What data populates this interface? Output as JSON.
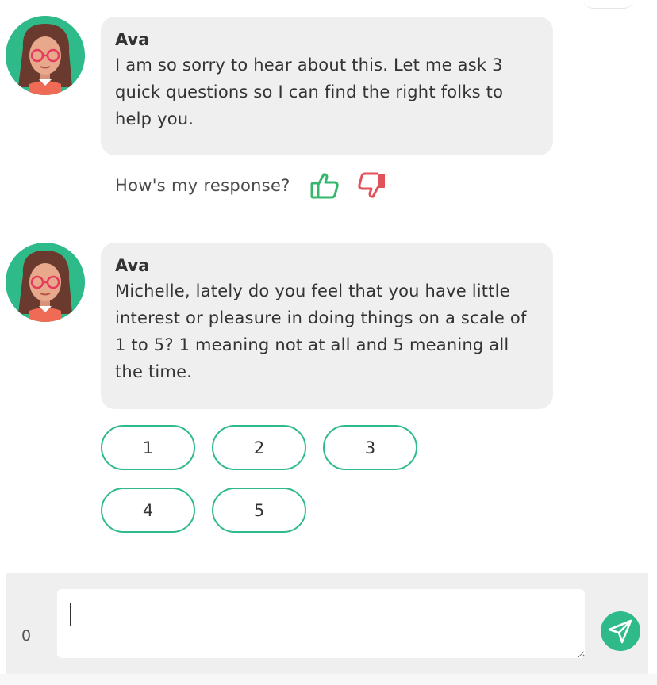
{
  "messages": [
    {
      "sender": "Ava",
      "text": "I am so sorry to hear about this. Let me ask 3 quick questions so I can find the right folks to help you."
    },
    {
      "sender": "Ava",
      "text": "Michelle, lately do you feel that you have little interest or pleasure in doing things on a scale of 1 to 5? 1 meaning not at all and 5 meaning all the time."
    }
  ],
  "feedback": {
    "label": "How's my response?",
    "up_icon": "thumbs-up-icon",
    "down_icon": "thumbs-down-icon",
    "up_color": "#35b86d",
    "down_color": "#e2525a"
  },
  "choices": [
    "1",
    "2",
    "3",
    "4",
    "5"
  ],
  "composer": {
    "counter": "0",
    "placeholder": "",
    "send_icon": "send-icon"
  },
  "colors": {
    "accent": "#2fba8a",
    "bubble": "#efefef",
    "text": "#333333"
  }
}
